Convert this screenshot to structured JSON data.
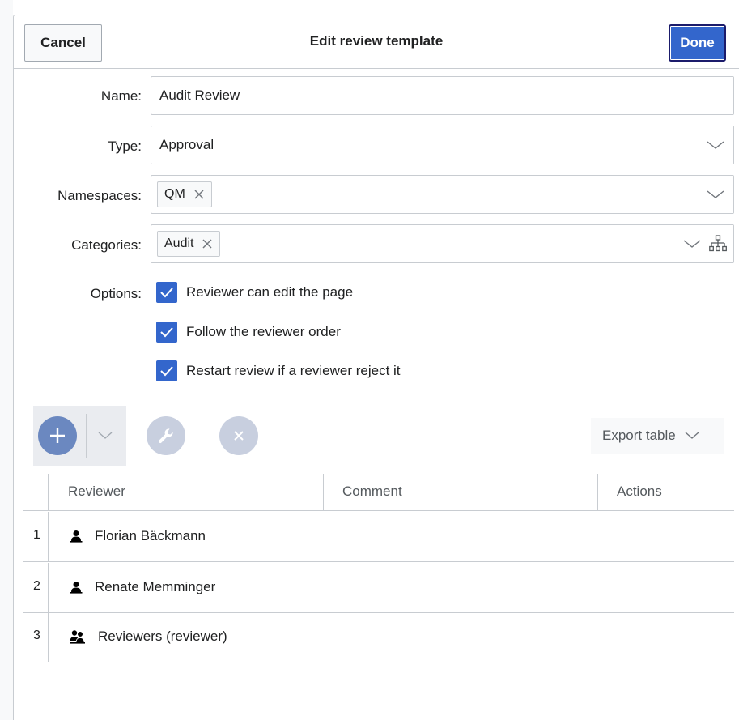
{
  "header": {
    "cancel_label": "Cancel",
    "title": "Edit review template",
    "done_label": "Done"
  },
  "form": {
    "name": {
      "label": "Name:",
      "value": "Audit Review"
    },
    "type": {
      "label": "Type:",
      "value": "Approval"
    },
    "namespaces": {
      "label": "Namespaces:",
      "tags": [
        "QM"
      ]
    },
    "categories": {
      "label": "Categories:",
      "tags": [
        "Audit"
      ]
    },
    "options": {
      "label": "Options:",
      "items": [
        {
          "label": "Reviewer can edit the page",
          "checked": true
        },
        {
          "label": "Follow the reviewer order",
          "checked": true
        },
        {
          "label": "Restart review if a reviewer reject it",
          "checked": true
        }
      ]
    }
  },
  "toolbar": {
    "icons": [
      "plus-icon",
      "chevron-down-icon",
      "wrench-icon",
      "close-icon"
    ],
    "export_label": "Export table"
  },
  "table": {
    "columns": [
      "Reviewer",
      "Comment",
      "Actions"
    ],
    "rows": [
      {
        "num": "1",
        "reviewer": "Florian Bäckmann",
        "icon": "user-icon"
      },
      {
        "num": "2",
        "reviewer": "Renate Memminger",
        "icon": "user-icon"
      },
      {
        "num": "3",
        "reviewer": "Reviewers (reviewer)",
        "icon": "user-group-icon"
      }
    ]
  },
  "colors": {
    "accent": "#3366cc",
    "border": "#c8ccd1",
    "muted": "#54595d",
    "disabled": "#c8cfdf"
  }
}
